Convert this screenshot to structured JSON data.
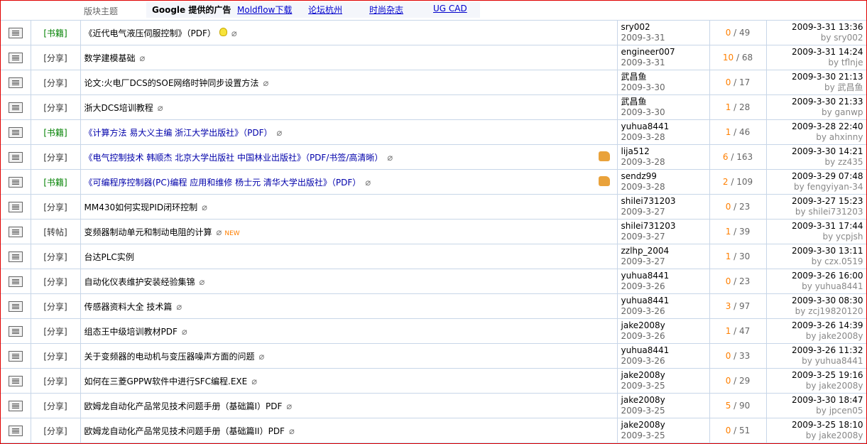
{
  "header": {
    "block_label": "版块主题",
    "ads_title": "Google 提供的广告",
    "ads": [
      "Moldflow下载",
      "论坛杭州",
      "时尚杂志",
      "UG CAD"
    ]
  },
  "rows": [
    {
      "cat": "[书籍]",
      "cat_color": "green",
      "subject": "《近代电气液压伺服控制》（PDF）",
      "hl": false,
      "bulb": true,
      "clip": true,
      "new": false,
      "thumb": false,
      "author": "sry002",
      "date": "2009-3-31",
      "replies": "0",
      "views": "49",
      "last_time": "2009-3-31 13:36",
      "last_by": "by sry002"
    },
    {
      "cat": "[分享]",
      "cat_color": "black",
      "subject": "数学建模基础",
      "hl": false,
      "bulb": false,
      "clip": true,
      "new": false,
      "thumb": false,
      "author": "engineer007",
      "date": "2009-3-31",
      "replies": "10",
      "views": "68",
      "last_time": "2009-3-31 14:24",
      "last_by": "by tflnje"
    },
    {
      "cat": "[分享]",
      "cat_color": "black",
      "subject": "论文:火电厂DCS的SOE网络时钟同步设置方法",
      "hl": false,
      "bulb": false,
      "clip": true,
      "new": false,
      "thumb": false,
      "author": "武昌鱼",
      "date": "2009-3-30",
      "replies": "0",
      "views": "17",
      "last_time": "2009-3-30 21:13",
      "last_by": "by 武昌鱼"
    },
    {
      "cat": "[分享]",
      "cat_color": "black",
      "subject": "浙大DCS培训教程",
      "hl": false,
      "bulb": false,
      "clip": true,
      "new": false,
      "thumb": false,
      "author": "武昌鱼",
      "date": "2009-3-30",
      "replies": "1",
      "views": "28",
      "last_time": "2009-3-30 21:33",
      "last_by": "by ganwp"
    },
    {
      "cat": "[书籍]",
      "cat_color": "green",
      "subject": "《计算方法 易大义主编 浙江大学出版社》（PDF）",
      "hl": true,
      "bulb": false,
      "clip": true,
      "new": false,
      "thumb": false,
      "author": "yuhua8441",
      "date": "2009-3-28",
      "replies": "1",
      "views": "46",
      "last_time": "2009-3-28 22:40",
      "last_by": "by ahxinny"
    },
    {
      "cat": "[分享]",
      "cat_color": "black",
      "subject": "《电气控制技术 韩顺杰 北京大学出版社 中国林业出版社》（PDF/书签/高清晰）",
      "hl": true,
      "bulb": false,
      "clip": true,
      "new": false,
      "thumb": true,
      "author": "lija512",
      "date": "2009-3-28",
      "replies": "6",
      "views": "163",
      "last_time": "2009-3-30 14:21",
      "last_by": "by zz435"
    },
    {
      "cat": "[书籍]",
      "cat_color": "green",
      "subject": "《可编程序控制器(PC)编程 应用和维修 杨士元 清华大学出版社》（PDF）",
      "hl": true,
      "bulb": false,
      "clip": true,
      "new": false,
      "thumb": true,
      "author": "sendz99",
      "date": "2009-3-28",
      "replies": "2",
      "views": "109",
      "last_time": "2009-3-29 07:48",
      "last_by": "by fengyiyan-34"
    },
    {
      "cat": "[分享]",
      "cat_color": "black",
      "subject": "MM430如何实现PID闭环控制",
      "hl": false,
      "bulb": false,
      "clip": true,
      "new": false,
      "thumb": false,
      "author": "shilei731203",
      "date": "2009-3-27",
      "replies": "0",
      "views": "23",
      "last_time": "2009-3-27 15:23",
      "last_by": "by shilei731203"
    },
    {
      "cat": "[转帖]",
      "cat_color": "black",
      "subject": "变频器制动单元和制动电阻的计算",
      "hl": false,
      "bulb": false,
      "clip": true,
      "new": true,
      "thumb": false,
      "author": "shilei731203",
      "date": "2009-3-27",
      "replies": "1",
      "views": "39",
      "last_time": "2009-3-31 17:44",
      "last_by": "by ycpjsh"
    },
    {
      "cat": "[分享]",
      "cat_color": "black",
      "subject": "台达PLC实例",
      "hl": false,
      "bulb": false,
      "clip": false,
      "new": false,
      "thumb": false,
      "author": "zzlhp_2004",
      "date": "2009-3-27",
      "replies": "1",
      "views": "30",
      "last_time": "2009-3-30 13:11",
      "last_by": "by czx.0519"
    },
    {
      "cat": "[分享]",
      "cat_color": "black",
      "subject": "自动化仪表维护安装经验集锦",
      "hl": false,
      "bulb": false,
      "clip": true,
      "new": false,
      "thumb": false,
      "author": "yuhua8441",
      "date": "2009-3-26",
      "replies": "0",
      "views": "23",
      "last_time": "2009-3-26 16:00",
      "last_by": "by yuhua8441"
    },
    {
      "cat": "[分享]",
      "cat_color": "black",
      "subject": "传感器资料大全 技术篇",
      "hl": false,
      "bulb": false,
      "clip": true,
      "new": false,
      "thumb": false,
      "author": "yuhua8441",
      "date": "2009-3-26",
      "replies": "3",
      "views": "97",
      "last_time": "2009-3-30 08:30",
      "last_by": "by zcj19820120"
    },
    {
      "cat": "[分享]",
      "cat_color": "black",
      "subject": "组态王中级培训教材PDF",
      "hl": false,
      "bulb": false,
      "clip": true,
      "new": false,
      "thumb": false,
      "author": "jake2008y",
      "date": "2009-3-26",
      "replies": "1",
      "views": "47",
      "last_time": "2009-3-26 14:39",
      "last_by": "by jake2008y"
    },
    {
      "cat": "[分享]",
      "cat_color": "black",
      "subject": "关于变频器的电动机与变压器噪声方面的问题",
      "hl": false,
      "bulb": false,
      "clip": true,
      "new": false,
      "thumb": false,
      "author": "yuhua8441",
      "date": "2009-3-26",
      "replies": "0",
      "views": "33",
      "last_time": "2009-3-26 11:32",
      "last_by": "by yuhua8441"
    },
    {
      "cat": "[分享]",
      "cat_color": "black",
      "subject": "如何在三菱GPPW软件中进行SFC编程.EXE",
      "hl": false,
      "bulb": false,
      "clip": true,
      "new": false,
      "thumb": false,
      "author": "jake2008y",
      "date": "2009-3-25",
      "replies": "0",
      "views": "29",
      "last_time": "2009-3-25 19:16",
      "last_by": "by jake2008y"
    },
    {
      "cat": "[分享]",
      "cat_color": "black",
      "subject": "欧姆龙自动化产品常见技术问题手册（基础篇I）PDF",
      "hl": false,
      "bulb": false,
      "clip": true,
      "new": false,
      "thumb": false,
      "author": "jake2008y",
      "date": "2009-3-25",
      "replies": "5",
      "views": "90",
      "last_time": "2009-3-30 18:47",
      "last_by": "by jpcen05"
    },
    {
      "cat": "[分享]",
      "cat_color": "black",
      "subject": "欧姆龙自动化产品常见技术问题手册（基础篇II）PDF",
      "hl": false,
      "bulb": false,
      "clip": true,
      "new": false,
      "thumb": false,
      "author": "jake2008y",
      "date": "2009-3-25",
      "replies": "0",
      "views": "51",
      "last_time": "2009-3-25 18:10",
      "last_by": "by jake2008y"
    }
  ]
}
